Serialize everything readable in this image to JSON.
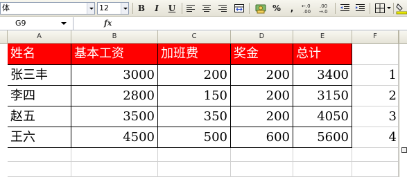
{
  "toolbar": {
    "font_name": "体",
    "font_size": "12",
    "bold": "B",
    "italic": "I",
    "underline": "U",
    "percent": "%",
    "comma": ",",
    "increase_decimal": "+.0 .00",
    "decrease_decimal": ".00 +.0",
    "icons": [
      "font-name-select",
      "font-size-select",
      "bold",
      "italic",
      "underline",
      "align-left",
      "align-center",
      "align-right",
      "merge-center",
      "currency",
      "percent",
      "comma",
      "increase-decimal",
      "decrease-decimal",
      "decrease-indent",
      "increase-indent",
      "borders"
    ]
  },
  "formula_bar": {
    "name_box": "G9",
    "fx": "fx",
    "formula": ""
  },
  "columns": [
    "A",
    "B",
    "C",
    "D",
    "E",
    "F"
  ],
  "table": {
    "header": [
      "姓名",
      "基本工资",
      "加班费",
      "奖金",
      "总计"
    ],
    "header_bg": "#ff0000",
    "header_color": "#ffffff",
    "rows": [
      [
        "张三丰",
        "3000",
        "200",
        "200",
        "3400",
        "1"
      ],
      [
        "李四",
        "2800",
        "150",
        "200",
        "3150",
        "2"
      ],
      [
        "赵五",
        "3500",
        "350",
        "200",
        "4050",
        "3"
      ],
      [
        "王六",
        "4500",
        "500",
        "600",
        "5600",
        "4"
      ]
    ]
  }
}
